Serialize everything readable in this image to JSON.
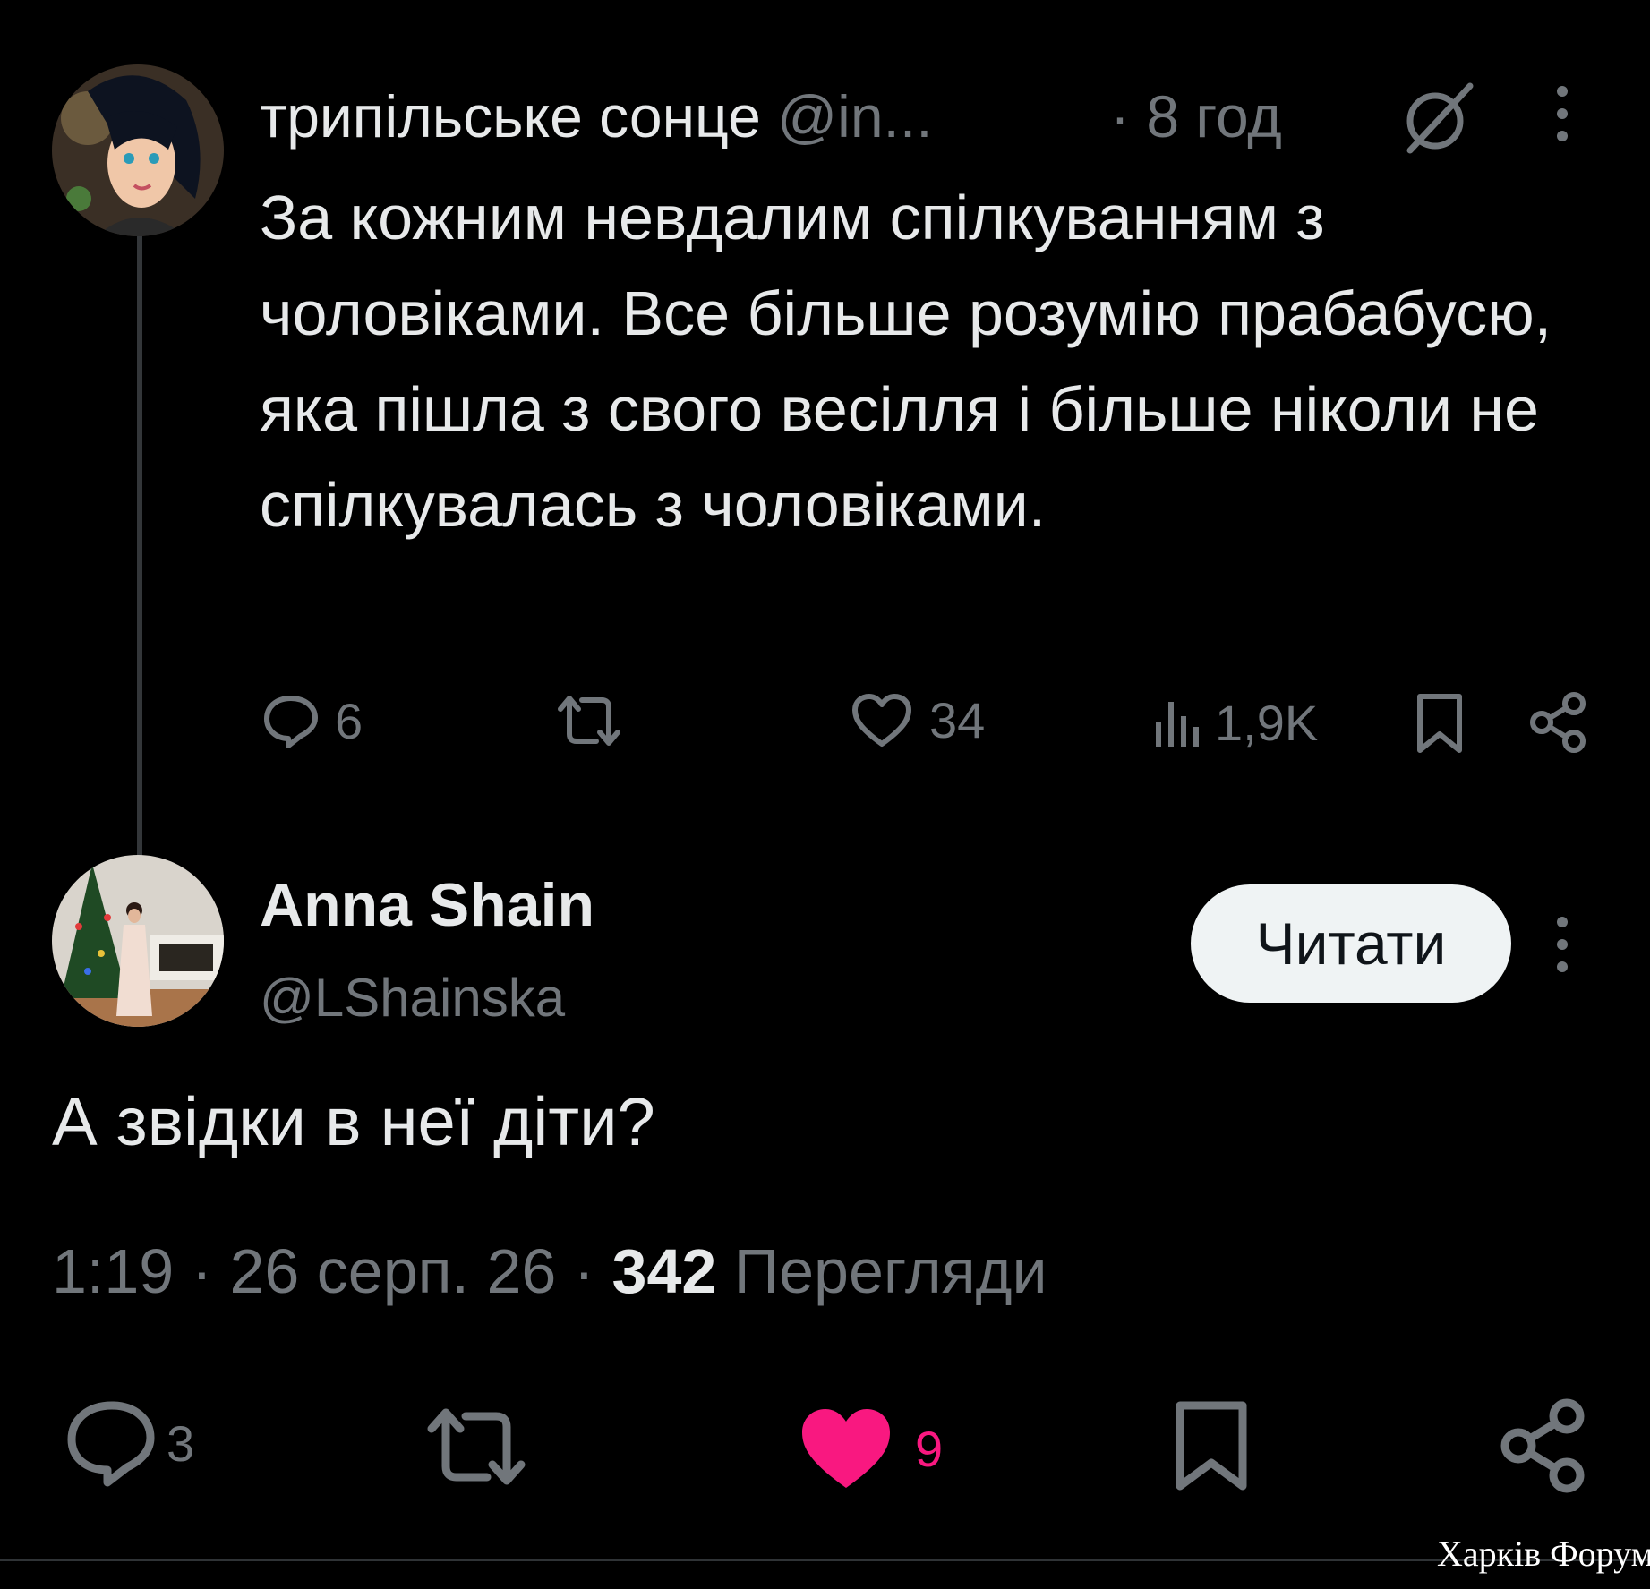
{
  "reply_to_tweet": {
    "display_name": "трипільське сонце",
    "handle": "@in...",
    "time": "· 8 год",
    "text": "За кожним невдалим спілкуванням з чоловіками. Все більше розумію прабабусю, яка пішла з свого весілля і більше ніколи не спілкувалась з чоловіками.",
    "actions": {
      "replies": "6",
      "likes": "34",
      "views": "1,9K"
    }
  },
  "main_tweet": {
    "display_name": "Anna Shain",
    "handle": "@LShainska",
    "follow_label": "Читати",
    "text": "А звідки в неї діти?",
    "time": "1:19",
    "date": "26 серп. 26",
    "views_count": "342",
    "views_label": "Перегляди",
    "actions": {
      "replies": "3",
      "likes": "9"
    }
  },
  "colors": {
    "background": "#000000",
    "primary_text": "#e7e9ea",
    "secondary_text": "#71767b",
    "like_active": "#f91880",
    "button_bg": "#eff3f4"
  },
  "watermark": "Харків Форум"
}
